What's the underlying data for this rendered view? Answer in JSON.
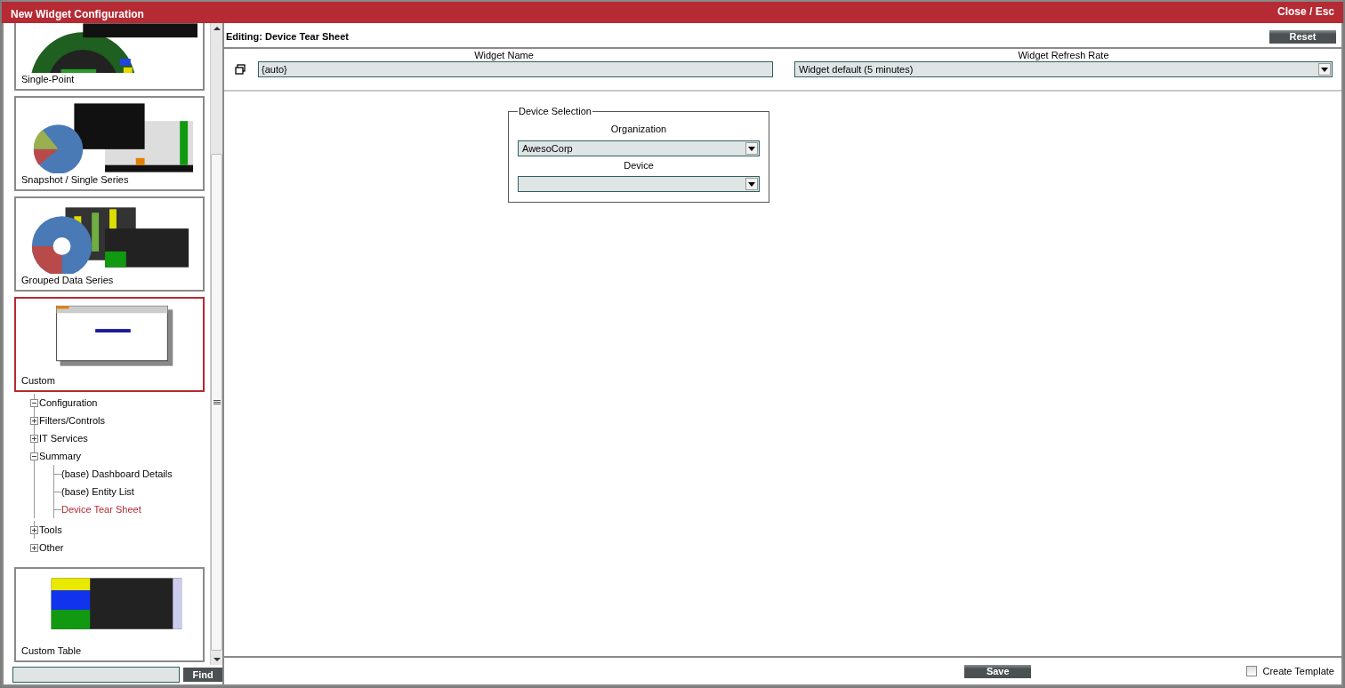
{
  "window": {
    "title": "New Widget Configuration",
    "close": "Close / Esc"
  },
  "sidebar": {
    "items": [
      {
        "kind": "card",
        "label": "Single-Point",
        "selected": false
      },
      {
        "kind": "card",
        "label": "Snapshot / Single Series",
        "selected": false
      },
      {
        "kind": "card",
        "label": "Grouped Data Series",
        "selected": false
      },
      {
        "kind": "card",
        "label": "Custom",
        "selected": true
      },
      {
        "kind": "tree",
        "nodes": [
          {
            "label": "Configuration",
            "expanded": true
          },
          {
            "label": "Filters/Controls",
            "expanded": false
          },
          {
            "label": "IT Services",
            "expanded": false
          },
          {
            "label": "Summary",
            "expanded": true,
            "children": [
              {
                "label": "(base) Dashboard Details",
                "selected": false
              },
              {
                "label": "(base) Entity List",
                "selected": false
              },
              {
                "label": "Device Tear Sheet",
                "selected": true
              }
            ]
          },
          {
            "label": "Tools",
            "expanded": false
          },
          {
            "label": "Other",
            "expanded": false
          }
        ]
      },
      {
        "kind": "card",
        "label": "Custom Table",
        "selected": false
      }
    ],
    "find_button": "Find"
  },
  "editor": {
    "heading": "Editing: Device Tear Sheet",
    "reset_button": "Reset",
    "widget_name": {
      "label": "Widget Name",
      "value": "{auto}"
    },
    "refresh_rate": {
      "label": "Widget Refresh Rate",
      "value": "Widget default (5 minutes)"
    },
    "device_selection": {
      "legend": "Device Selection",
      "fields": [
        {
          "label": "Organization",
          "value": "AwesoCorp"
        },
        {
          "label": "Device"
        }
      ]
    }
  },
  "footer": {
    "save_button": "Save",
    "create_template": {
      "label": "Create Template",
      "checked": false
    }
  }
}
